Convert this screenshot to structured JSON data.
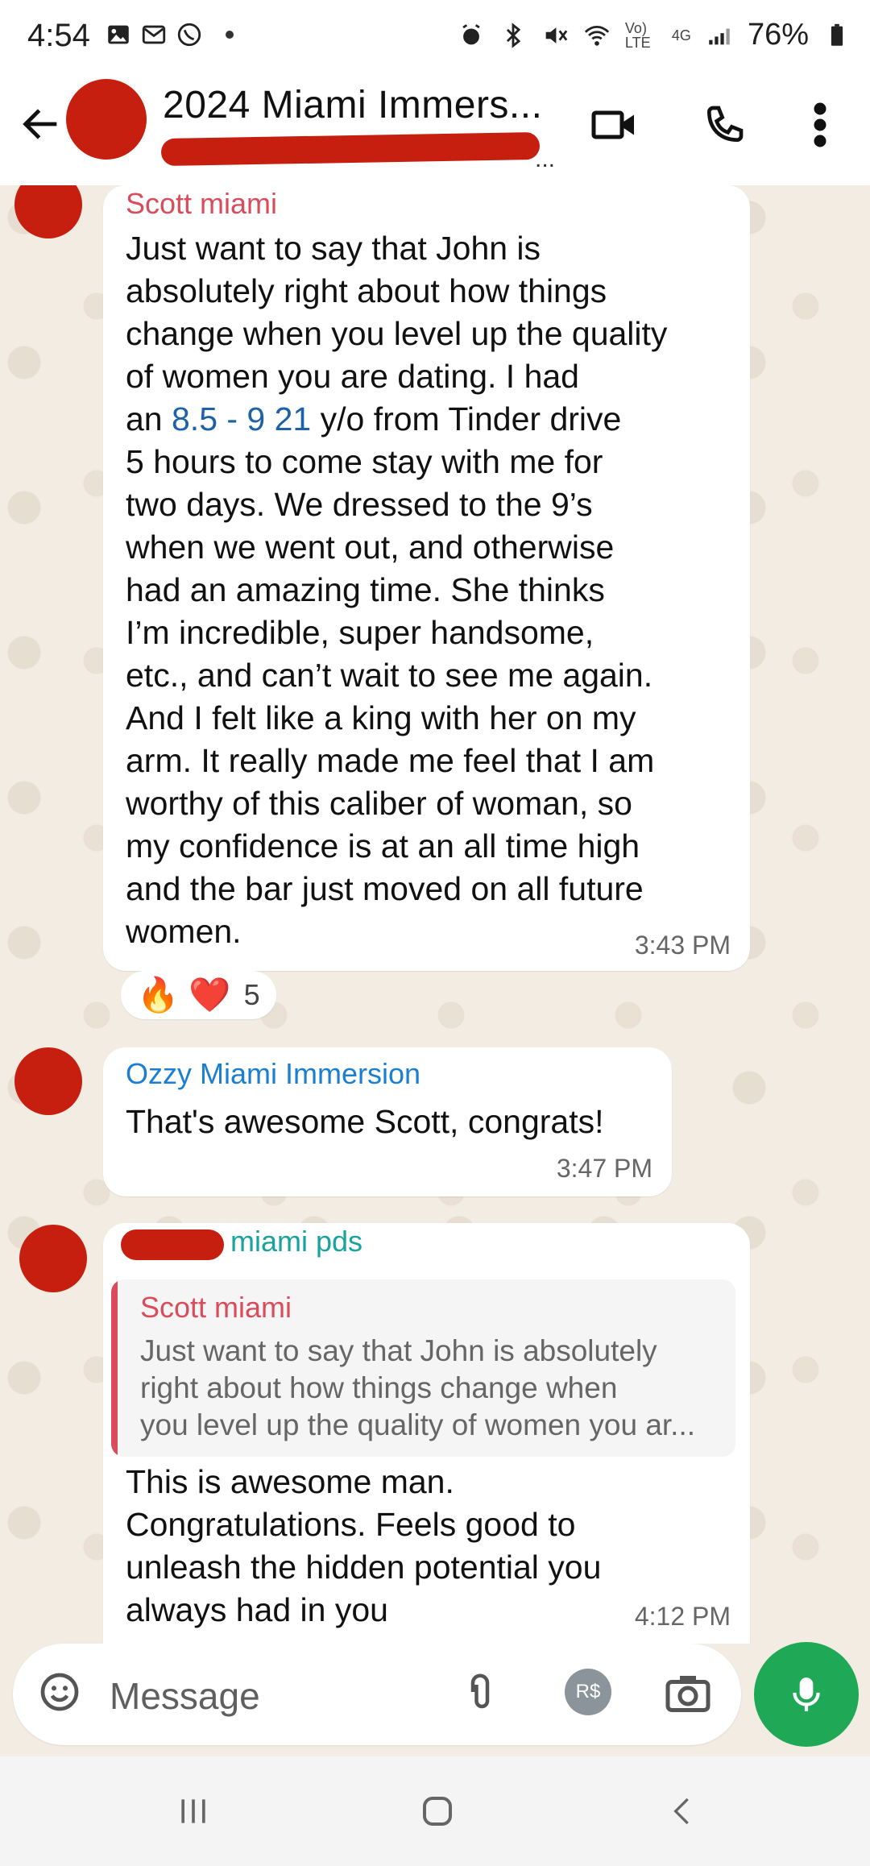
{
  "status": {
    "time": "4:54",
    "network_top": "Vo) LTE",
    "network_gen": "4G",
    "battery": "76%"
  },
  "header": {
    "title": "2024 Miami Immers...",
    "subtitle_ellipsis": "..."
  },
  "messages": [
    {
      "sender": "Scott miami",
      "sender_color": "#d94c5c",
      "text_lines": [
        "Just want to say that John is",
        "absolutely right about how things",
        "change when you level up the quality",
        "of women you are dating.  I had",
        "an ",
        "8.5 - 9 21",
        " y/o from Tinder drive",
        "5 hours to come stay with me for",
        "two days.   We dressed to the 9’s",
        "when we went out, and otherwise",
        "had an amazing time.   She thinks",
        "I’m incredible, super handsome,",
        "etc., and can’t wait to see me again.",
        "And I felt like a king with her on my",
        "arm.  It really made me feel that I am",
        "worthy of this caliber of woman, so",
        "my confidence is at an all time high",
        "and the bar just moved on all future",
        "women."
      ],
      "time": "3:43 PM",
      "reactions": [
        "🔥",
        "❤️"
      ],
      "reaction_count": "5"
    },
    {
      "sender": "Ozzy Miami Immersion",
      "sender_color": "#1b7fd1",
      "text": "That's awesome Scott, congrats!",
      "time": "3:47 PM"
    },
    {
      "sender": "miami pds",
      "sender_color": "#1aa39a",
      "quote_name": "Scott miami",
      "quote_lines": [
        "Just want to say that John is absolutely",
        "right about how things change when",
        "you level up the quality of women you ar..."
      ],
      "text_lines": [
        "This is awesome man.",
        "Congratulations. Feels good to",
        "unleash the hidden potential you",
        "always had in you"
      ],
      "time": "4:12 PM"
    }
  ],
  "composer": {
    "placeholder": "Message",
    "pay_label": "R$"
  },
  "icons": {
    "back": "back-arrow-icon",
    "video": "video-call-icon",
    "phone": "phone-call-icon",
    "menu": "more-vert-icon",
    "emoji": "emoji-icon",
    "attach": "paperclip-icon",
    "camera": "camera-icon",
    "mic": "microphone-icon"
  },
  "colors": {
    "accent_green": "#1fa855",
    "link_blue": "#1d62a8",
    "redaction": "#c61f0f"
  }
}
